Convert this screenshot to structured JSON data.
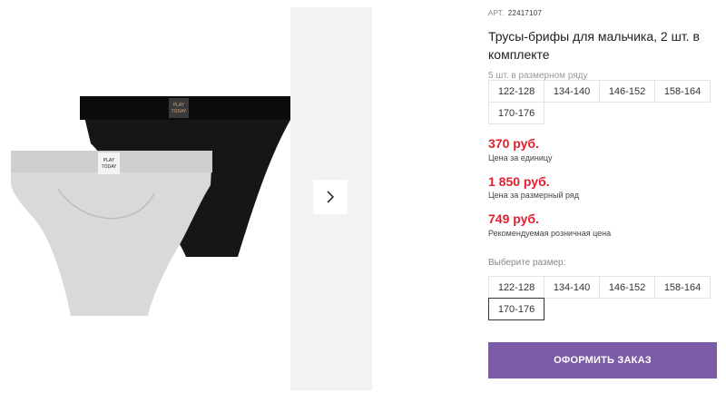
{
  "product": {
    "sku_label": "АРТ.",
    "sku_number": "22417107",
    "title": "Трусы-брифы для мальчика, 2 шт. в комплекте",
    "range_note": "5 шт. в размерном ряду",
    "range_sizes": [
      "122-128",
      "134-140",
      "146-152",
      "158-164",
      "170-176"
    ],
    "prices": [
      {
        "value": "370 руб.",
        "note": "Цена за единицу"
      },
      {
        "value": "1 850 руб.",
        "note": "Цена за размерный ряд"
      },
      {
        "value": "749 руб.",
        "note": "Рекомендуемая розничная цена"
      }
    ],
    "choose_label": "Выберите размер:",
    "choose_sizes": [
      "122-128",
      "134-140",
      "146-152",
      "158-164",
      "170-176"
    ],
    "selected_size": "170-176",
    "order_button": "ОФОРМИТЬ ЗАКАЗ"
  },
  "image": {
    "brand_line1": "PLAY",
    "brand_line2": "TODAY",
    "colors": {
      "dark": "#161616",
      "light": "#d9d9d9"
    }
  },
  "icons": {
    "next": "chevron-right-icon"
  },
  "colors": {
    "price": "#e0202e",
    "accent": "#7b5ba6"
  }
}
